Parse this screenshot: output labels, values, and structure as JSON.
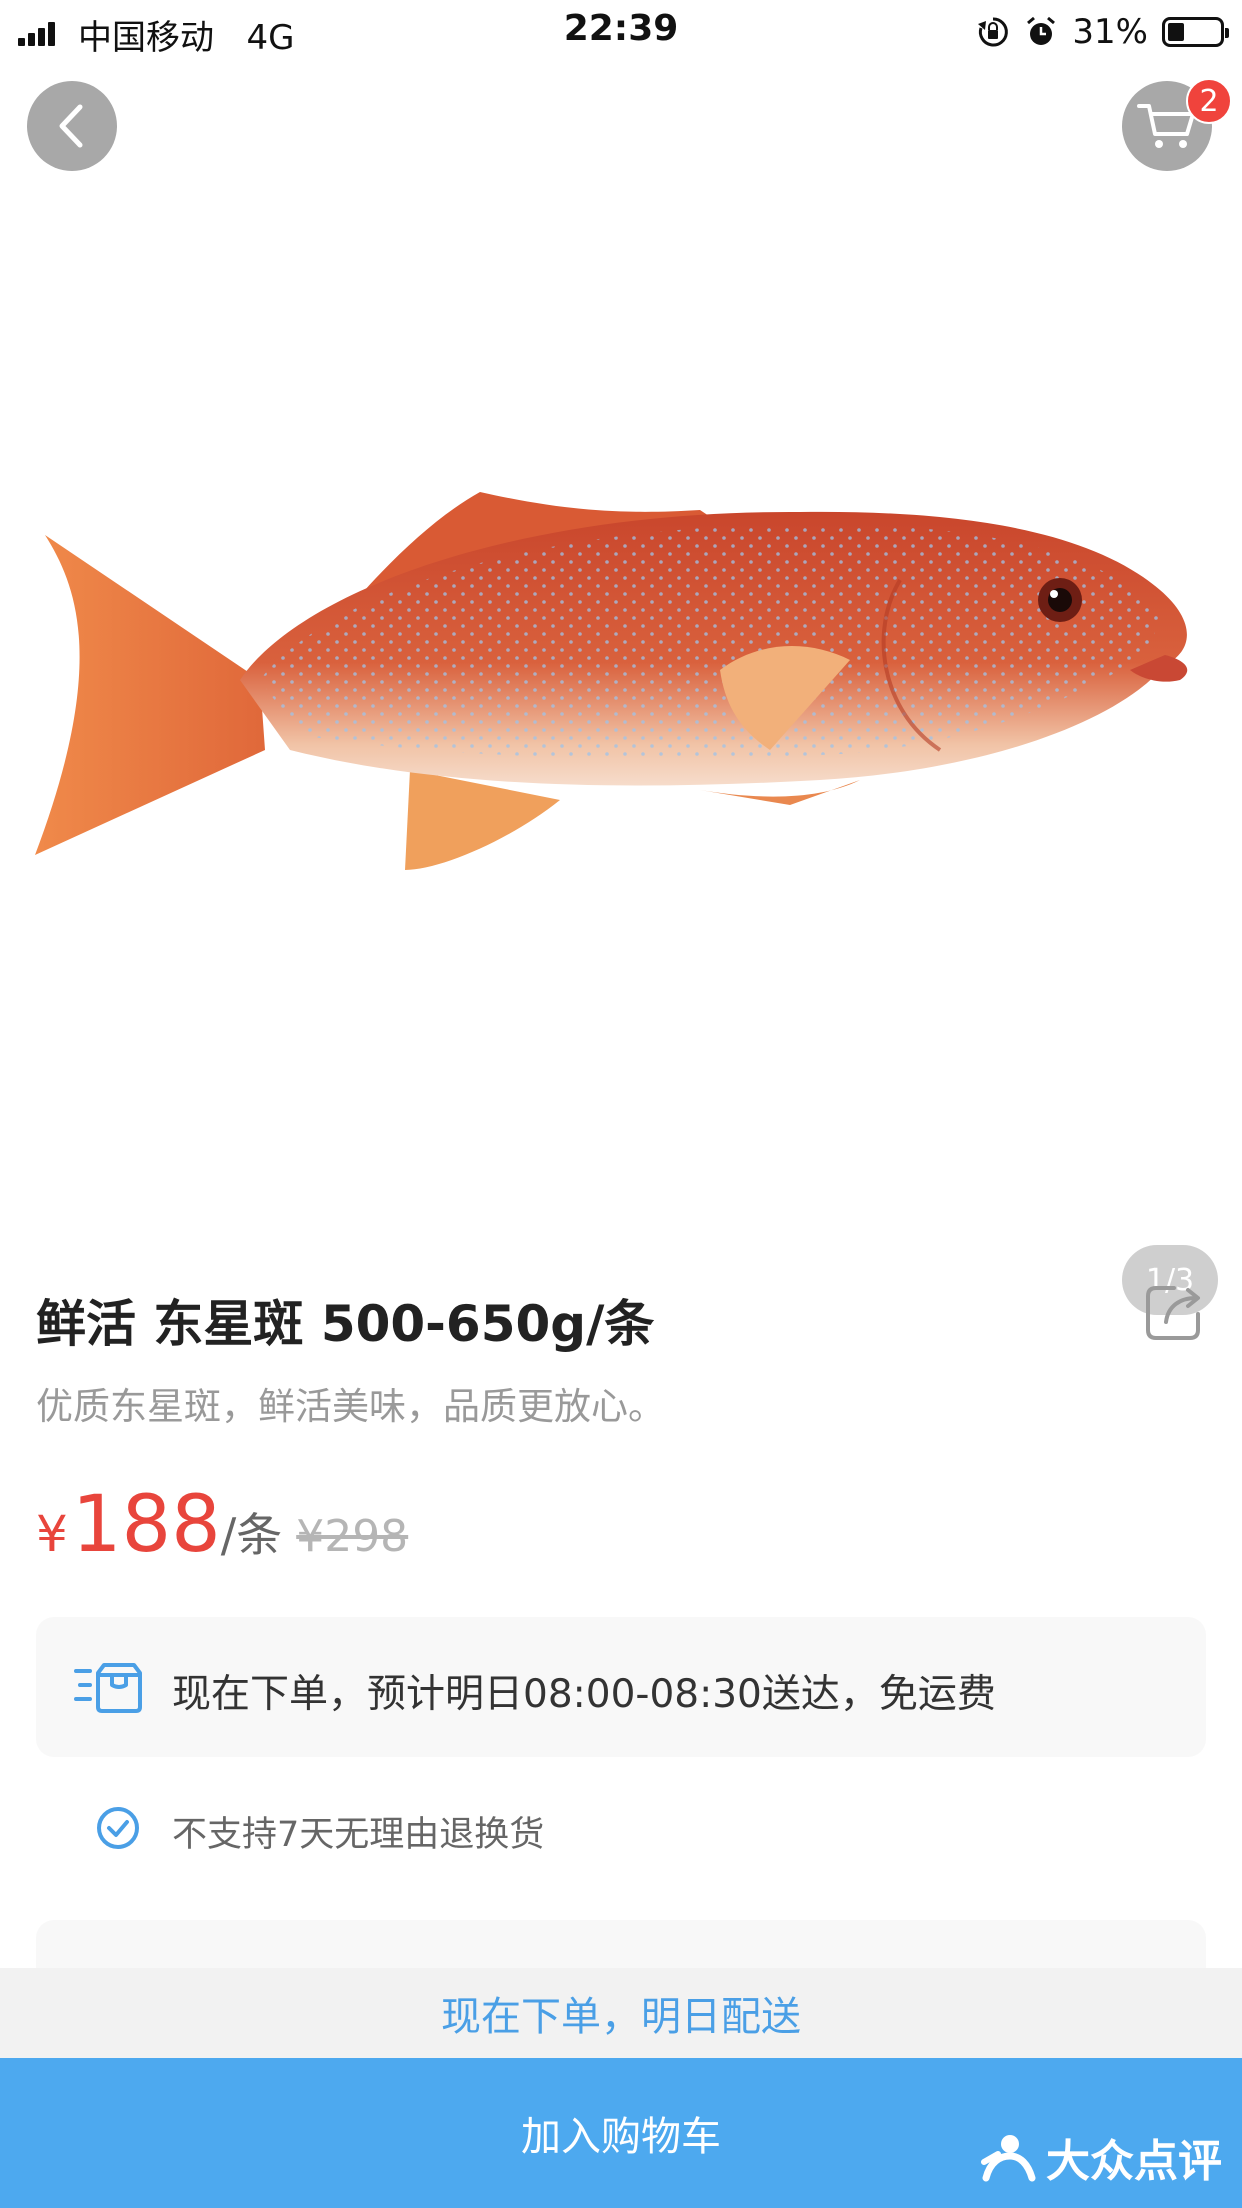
{
  "status_bar": {
    "carrier": "中国移动",
    "network": "4G",
    "time": "22:39",
    "battery_pct": "31%",
    "battery_level": 0.31
  },
  "header": {
    "back_icon": "chevron-left-icon",
    "cart_icon": "cart-icon",
    "cart_count": "2"
  },
  "gallery": {
    "page_indicator": "1/3",
    "image": "red-grouper-fish"
  },
  "product": {
    "title": "鲜活 东星斑 500-650g/条",
    "subtitle": "优质东星斑，鲜活美味，品质更放心。",
    "price_symbol": "¥",
    "price": "188",
    "price_unit": "/条",
    "original_price": "¥298"
  },
  "delivery": {
    "icon": "delivery-box-icon",
    "text": "现在下单，预计明日08:00-08:30送达，免运费"
  },
  "policy": {
    "icon": "check-circle-icon",
    "text": "不支持7天无理由退换货"
  },
  "bottom": {
    "notice": "现在下单，明日配送",
    "add_to_cart": "加入购物车"
  },
  "watermark": {
    "text": "大众点评"
  },
  "colors": {
    "price_red": "#e8453c",
    "accent_blue": "#4da9ef",
    "badge_red": "#f0433c"
  }
}
